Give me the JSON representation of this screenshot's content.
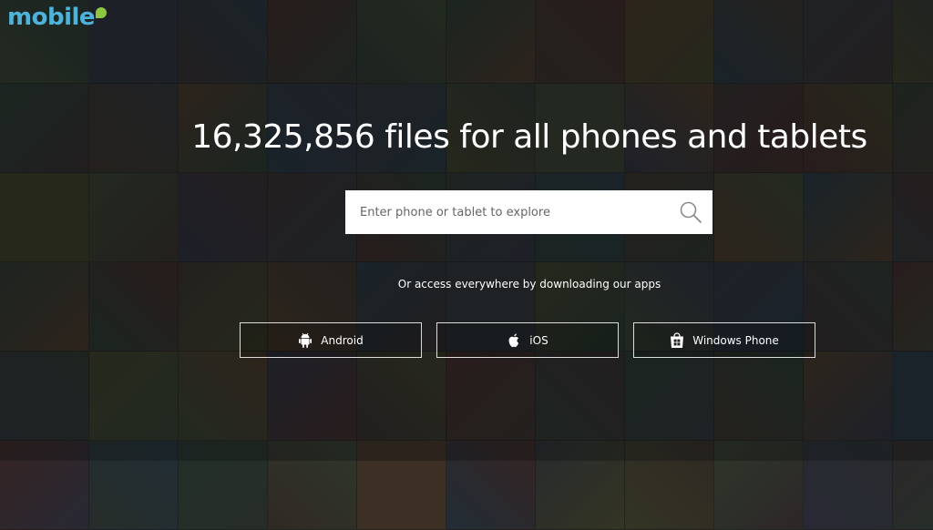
{
  "brand": {
    "logo_text": "mobile",
    "logo_color": "#4fb3d9",
    "logo_mark_color": "#8dc63f"
  },
  "hero": {
    "headline": "16,325,856 files for all phones and tablets",
    "subtext": "Or access everywhere by downloading our apps"
  },
  "search": {
    "placeholder": "Enter phone or tablet to explore",
    "value": "",
    "icon": "search-icon"
  },
  "apps": [
    {
      "label": "Android",
      "icon": "android-icon"
    },
    {
      "label": "iOS",
      "icon": "apple-icon"
    },
    {
      "label": "Windows Phone",
      "icon": "windows-store-icon"
    }
  ],
  "colors": {
    "headline": "#ffffff",
    "search_bg": "#ffffff",
    "button_border": "#ffffff",
    "tiles": [
      "#4a5a3a",
      "#3c3f44",
      "#6a4a2a",
      "#2f4a3a",
      "#5a2f2a",
      "#3a3a52",
      "#55552a",
      "#2a4455",
      "#4d3b2d",
      "#384438",
      "#463636"
    ]
  }
}
